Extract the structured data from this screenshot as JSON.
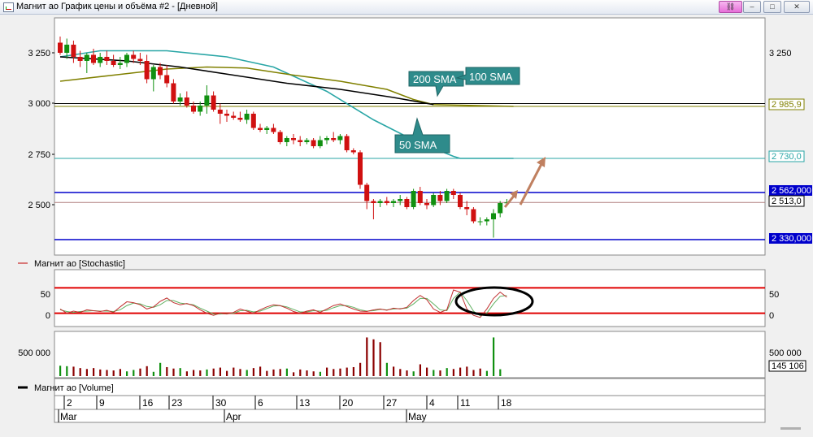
{
  "window": {
    "title": "Магнит ао График цены и объёма #2 - [Дневной]",
    "buttons": {
      "link": "⛓",
      "minimize": "–",
      "maximize": "□",
      "close": "✕"
    }
  },
  "price_panel": {
    "left_ticks": [
      "3 250",
      "3 000",
      "2 750",
      "2 500"
    ],
    "right_ticks": [
      "3 250"
    ],
    "right_badges": [
      {
        "text": "2 985,9",
        "color": "#808000",
        "bg": "#ffffff"
      },
      {
        "text": "2 730,0",
        "color": "#2aa6a6",
        "bg": "#ffffff"
      },
      {
        "text": "2 562,000",
        "color": "#ffffff",
        "bg": "#0000cc"
      },
      {
        "text": "2 513,0",
        "color": "#000000",
        "bg": "#ffffff"
      },
      {
        "text": "2 330,000",
        "color": "#ffffff",
        "bg": "#0000cc"
      }
    ],
    "callouts": [
      "200 SMA",
      "100 SMA",
      "50 SMA"
    ]
  },
  "stochastic_panel": {
    "legend": "Магнит ао [Stochastic]",
    "left_ticks": [
      "50",
      "0"
    ],
    "right_ticks": [
      "50",
      "0"
    ]
  },
  "volume_panel": {
    "legend": "Магнит ао [Volume]",
    "left_ticks": [
      "500 000"
    ],
    "right_ticks": [
      "500 000"
    ],
    "right_badge": "145 106"
  },
  "date_axis": {
    "days": [
      "2",
      "9",
      "16",
      "23",
      "30",
      "6",
      "13",
      "20",
      "27",
      "4",
      "11",
      "18"
    ],
    "months": [
      "Mar",
      "Apr",
      "May"
    ]
  },
  "chart_data": {
    "type": "candlestick",
    "series": [
      {
        "name": "Магнит ао",
        "kind": "ohlc",
        "values": [
          [
            3300,
            3330,
            3240,
            3250
          ],
          [
            3250,
            3320,
            3220,
            3290
          ],
          [
            3290,
            3310,
            3200,
            3230
          ],
          [
            3230,
            3260,
            3180,
            3210
          ],
          [
            3210,
            3250,
            3150,
            3240
          ],
          [
            3240,
            3270,
            3190,
            3200
          ],
          [
            3200,
            3250,
            3180,
            3230
          ],
          [
            3230,
            3260,
            3190,
            3210
          ],
          [
            3210,
            3240,
            3180,
            3190
          ],
          [
            3190,
            3230,
            3170,
            3200
          ],
          [
            3200,
            3250,
            3180,
            3240
          ],
          [
            3240,
            3260,
            3200,
            3220
          ],
          [
            3220,
            3250,
            3190,
            3210
          ],
          [
            3210,
            3240,
            3100,
            3120
          ],
          [
            3120,
            3190,
            3060,
            3180
          ],
          [
            3180,
            3200,
            3120,
            3140
          ],
          [
            3140,
            3190,
            3080,
            3100
          ],
          [
            3100,
            3120,
            3000,
            3010
          ],
          [
            3010,
            3050,
            2990,
            3030
          ],
          [
            3030,
            3060,
            2980,
            2990
          ],
          [
            2990,
            3010,
            2950,
            2960
          ],
          [
            2960,
            3010,
            2940,
            2990
          ],
          [
            2990,
            3090,
            2950,
            3040
          ],
          [
            3040,
            3060,
            2960,
            2970
          ],
          [
            2970,
            3000,
            2900,
            2950
          ],
          [
            2950,
            2970,
            2910,
            2940
          ],
          [
            2940,
            2960,
            2920,
            2930
          ],
          [
            2930,
            2960,
            2910,
            2920
          ],
          [
            2920,
            2970,
            2900,
            2950
          ],
          [
            2950,
            2960,
            2870,
            2880
          ],
          [
            2880,
            2900,
            2860,
            2870
          ],
          [
            2870,
            2890,
            2850,
            2880
          ],
          [
            2880,
            2900,
            2850,
            2860
          ],
          [
            2860,
            2870,
            2800,
            2810
          ],
          [
            2810,
            2840,
            2790,
            2830
          ],
          [
            2830,
            2850,
            2800,
            2820
          ],
          [
            2820,
            2840,
            2790,
            2810
          ],
          [
            2810,
            2830,
            2800,
            2820
          ],
          [
            2820,
            2830,
            2780,
            2790
          ],
          [
            2790,
            2840,
            2780,
            2820
          ],
          [
            2820,
            2840,
            2800,
            2830
          ],
          [
            2830,
            2860,
            2810,
            2820
          ],
          [
            2820,
            2850,
            2800,
            2840
          ],
          [
            2840,
            2850,
            2760,
            2770
          ],
          [
            2770,
            2780,
            2750,
            2760
          ],
          [
            2760,
            2770,
            2580,
            2600
          ],
          [
            2600,
            2610,
            2480,
            2520
          ],
          [
            2520,
            2530,
            2430,
            2510
          ],
          [
            2510,
            2530,
            2490,
            2520
          ],
          [
            2520,
            2540,
            2500,
            2510
          ],
          [
            2510,
            2530,
            2490,
            2520
          ],
          [
            2520,
            2550,
            2500,
            2530
          ],
          [
            2530,
            2540,
            2480,
            2490
          ],
          [
            2490,
            2580,
            2480,
            2570
          ],
          [
            2570,
            2590,
            2500,
            2510
          ],
          [
            2510,
            2530,
            2480,
            2500
          ],
          [
            2500,
            2560,
            2490,
            2550
          ],
          [
            2550,
            2570,
            2500,
            2520
          ],
          [
            2520,
            2580,
            2510,
            2570
          ],
          [
            2570,
            2580,
            2530,
            2550
          ],
          [
            2550,
            2560,
            2480,
            2490
          ],
          [
            2490,
            2520,
            2450,
            2480
          ],
          [
            2480,
            2490,
            2410,
            2420
          ],
          [
            2420,
            2440,
            2400,
            2420
          ],
          [
            2420,
            2440,
            2400,
            2430
          ],
          [
            2430,
            2480,
            2340,
            2460
          ],
          [
            2460,
            2520,
            2440,
            2510
          ],
          [
            2510,
            2530,
            2500,
            2513
          ]
        ]
      },
      {
        "name": "50 SMA",
        "kind": "line",
        "color": "#2aa6a6",
        "values": [
          [
            0,
            3230
          ],
          [
            6,
            3260
          ],
          [
            16,
            3260
          ],
          [
            25,
            3230
          ],
          [
            32,
            3180
          ],
          [
            40,
            3060
          ],
          [
            47,
            2920
          ],
          [
            53,
            2820
          ],
          [
            59,
            2740
          ],
          [
            60,
            2730
          ],
          [
            68,
            2730
          ]
        ]
      },
      {
        "name": "100 SMA",
        "kind": "line",
        "color": "#808000",
        "values": [
          [
            0,
            3110
          ],
          [
            8,
            3140
          ],
          [
            16,
            3170
          ],
          [
            22,
            3180
          ],
          [
            28,
            3175
          ],
          [
            35,
            3140
          ],
          [
            42,
            3110
          ],
          [
            49,
            3070
          ],
          [
            53,
            3020
          ],
          [
            56,
            2995
          ],
          [
            68,
            2986
          ]
        ]
      },
      {
        "name": "200 SMA",
        "kind": "line",
        "color": "#000000",
        "values": [
          [
            0,
            3230
          ],
          [
            10,
            3210
          ],
          [
            18,
            3180
          ],
          [
            26,
            3140
          ],
          [
            34,
            3100
          ],
          [
            42,
            3070
          ],
          [
            50,
            3030
          ],
          [
            56,
            2995
          ]
        ]
      }
    ],
    "horizontal_lines": [
      2985.9,
      3000,
      2730,
      2562,
      2513,
      2330
    ],
    "stochastic": {
      "levels": [
        80,
        20
      ],
      "k": [
        30,
        20,
        25,
        22,
        28,
        26,
        24,
        27,
        22,
        35,
        47,
        45,
        40,
        30,
        35,
        48,
        56,
        45,
        40,
        43,
        38,
        28,
        20,
        15,
        20,
        18,
        22,
        30,
        25,
        20,
        28,
        35,
        40,
        38,
        32,
        24,
        20,
        25,
        28,
        22,
        30,
        38,
        42,
        36,
        30,
        25,
        24,
        28,
        30,
        27,
        32,
        30,
        34,
        50,
        62,
        52,
        30,
        22,
        28,
        75,
        70,
        30,
        15,
        10,
        30,
        55,
        70,
        58
      ],
      "d": [
        28,
        24,
        22,
        24,
        25,
        26,
        25,
        25,
        24,
        28,
        38,
        44,
        42,
        36,
        34,
        40,
        50,
        50,
        44,
        42,
        40,
        32,
        25,
        18,
        18,
        19,
        20,
        26,
        27,
        23,
        25,
        31,
        37,
        38,
        35,
        29,
        23,
        23,
        26,
        25,
        27,
        33,
        38,
        38,
        34,
        28,
        25,
        26,
        29,
        28,
        30,
        31,
        32,
        42,
        55,
        55,
        42,
        28,
        26,
        55,
        70,
        50,
        25,
        14,
        20,
        42,
        60,
        62
      ]
    },
    "volume": [
      220000,
      210000,
      200000,
      170000,
      150000,
      170000,
      140000,
      130000,
      120000,
      150000,
      100000,
      130000,
      160000,
      210000,
      90000,
      280000,
      190000,
      160000,
      170000,
      100000,
      130000,
      120000,
      140000,
      160000,
      180000,
      110000,
      180000,
      150000,
      130000,
      170000,
      200000,
      110000,
      140000,
      150000,
      160000,
      80000,
      140000,
      120000,
      100000,
      90000,
      180000,
      150000,
      160000,
      180000,
      190000,
      280000,
      820000,
      780000,
      720000,
      280000,
      200000,
      150000,
      120000,
      100000,
      250000,
      180000,
      130000,
      120000,
      170000,
      150000,
      180000,
      200000,
      130000,
      160000,
      110000,
      820000,
      145106
    ],
    "volume_up": [
      true,
      true,
      false,
      false,
      false,
      false,
      false,
      false,
      false,
      false,
      true,
      true,
      false,
      false,
      true,
      true,
      false,
      false,
      true,
      false,
      false,
      false,
      true,
      false,
      false,
      false,
      false,
      false,
      true,
      false,
      false,
      false,
      false,
      false,
      true,
      false,
      false,
      false,
      false,
      true,
      false,
      false,
      false,
      false,
      false,
      false,
      false,
      false,
      false,
      true,
      false,
      false,
      false,
      true,
      false,
      false,
      true,
      false,
      true,
      false,
      false,
      false,
      false,
      false,
      true,
      true,
      true
    ]
  }
}
